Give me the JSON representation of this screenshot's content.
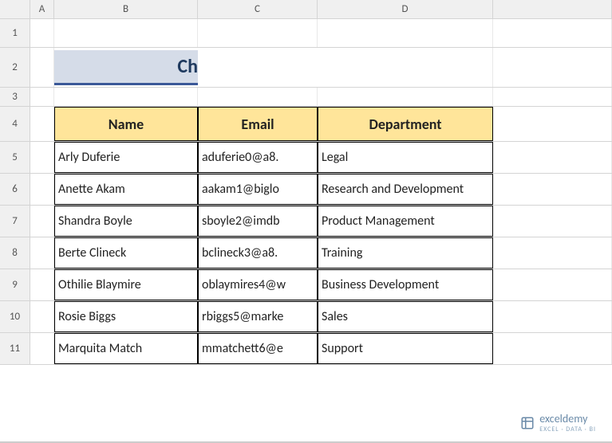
{
  "columns": [
    "A",
    "B",
    "C",
    "D"
  ],
  "rows": [
    "1",
    "2",
    "3",
    "4",
    "5",
    "6",
    "7",
    "8",
    "9",
    "10",
    "11"
  ],
  "title": "Change Cell Size in Excel",
  "headers": {
    "name": "Name",
    "email": "Email",
    "department": "Department"
  },
  "data": [
    {
      "name": "Arly Duferie",
      "email": "aduferie0@a8.",
      "department": "Legal"
    },
    {
      "name": "Anette Akam",
      "email": "aakam1@biglo",
      "department": "Research and Development"
    },
    {
      "name": "Shandra Boyle",
      "email": "sboyle2@imdb",
      "department": "Product Management"
    },
    {
      "name": "Berte Clineck",
      "email": "bclineck3@a8.",
      "department": "Training"
    },
    {
      "name": "Othilie Blaymire",
      "email": "oblaymires4@w",
      "department": "Business Development"
    },
    {
      "name": "Rosie Biggs",
      "email": "rbiggs5@marke",
      "department": "Sales"
    },
    {
      "name": "Marquita Match",
      "email": "mmatchett6@e",
      "department": "Support"
    }
  ],
  "watermark": {
    "name": "exceldemy",
    "sub": "EXCEL · DATA · BI"
  }
}
